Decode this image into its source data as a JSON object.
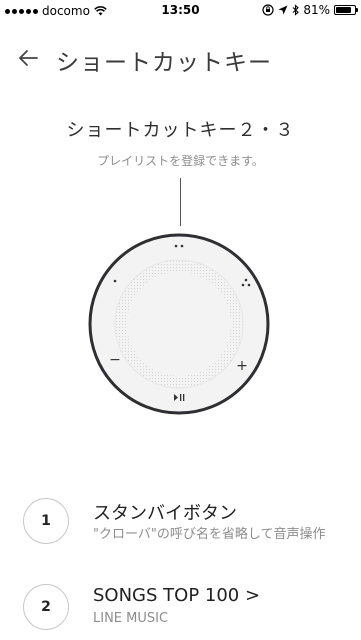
{
  "status_bar": {
    "carrier": "docomo",
    "time": "13:50",
    "battery": "81%",
    "battery_level": 0.81
  },
  "header": {
    "title": "ショートカットキー"
  },
  "shortcut": {
    "title": "ショートカットキー２・３",
    "subtitle": "プレイリストを登録できます。"
  },
  "dial": {
    "minus_label": "−",
    "plus_label": "+",
    "play_label": "▸॥"
  },
  "items": [
    {
      "number": "1",
      "title": "スタンバイボタン",
      "desc": "\"クローバ\"の呼び名を省略して音声操作"
    },
    {
      "number": "2",
      "title": "SONGS TOP 100 >",
      "desc": "LINE MUSIC"
    }
  ]
}
